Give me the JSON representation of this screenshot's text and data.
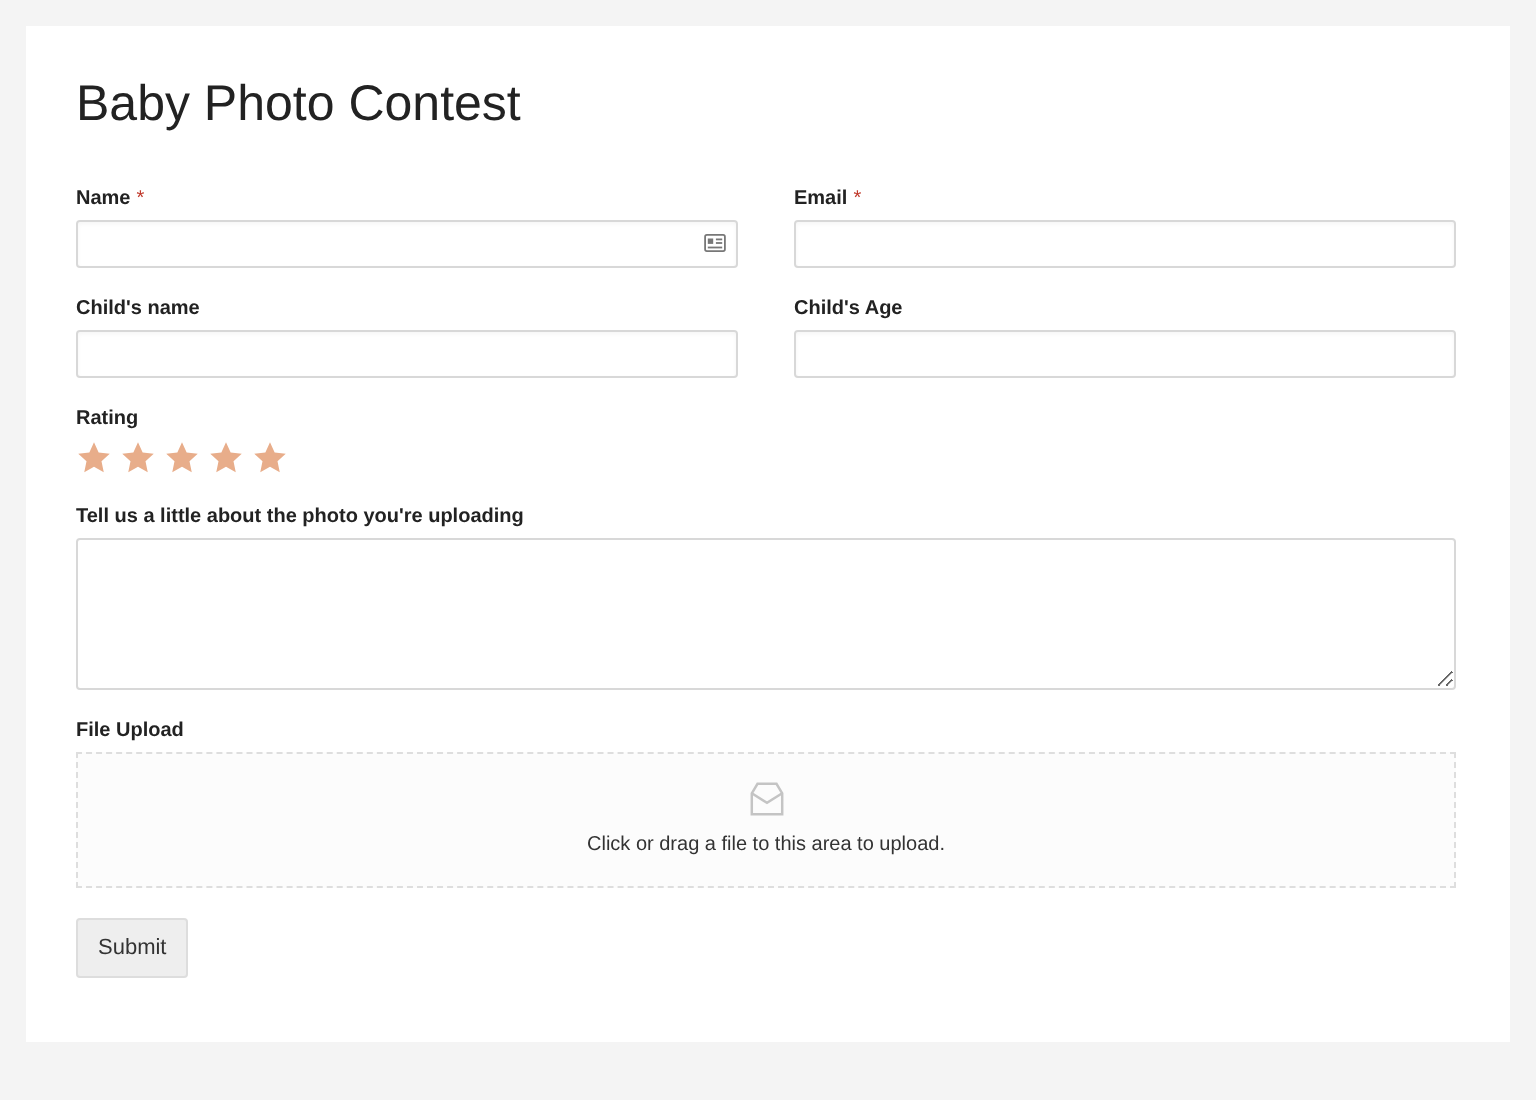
{
  "title": "Baby Photo Contest",
  "rows": [
    [
      {
        "kind": "text",
        "label": "Name",
        "required_mark": "*",
        "autofill": true
      },
      {
        "kind": "text",
        "label": "Email",
        "required_mark": "*"
      }
    ],
    [
      {
        "kind": "text",
        "label": "Child's name"
      },
      {
        "kind": "text",
        "label": "Child's Age"
      }
    ],
    [
      {
        "kind": "rating",
        "label": "Rating",
        "stars": 5
      }
    ],
    [
      {
        "kind": "textarea",
        "label": "Tell us a little about the photo you're uploading"
      }
    ],
    [
      {
        "kind": "upload",
        "label": "File Upload",
        "hint": "Click or drag a file to this area to upload."
      }
    ]
  ],
  "submit": "Submit"
}
